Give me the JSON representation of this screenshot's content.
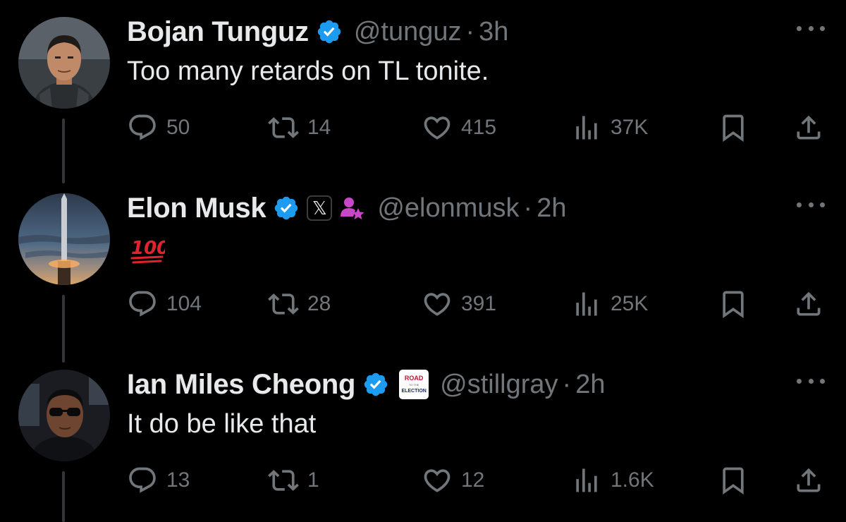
{
  "colors": {
    "background": "#000000",
    "text_primary": "#e7e9ea",
    "text_secondary": "#71767b",
    "verified_blue": "#1d9bf0",
    "affiliate_purple": "#c846c8"
  },
  "tweets": [
    {
      "name": "Bojan Tunguz",
      "handle": "@tunguz",
      "separator": "·",
      "time": "3h",
      "text": "Too many retards on TL tonite.",
      "replies": "50",
      "reposts": "14",
      "likes": "415",
      "views": "37K",
      "badges": [
        "verified-badge-icon"
      ]
    },
    {
      "name": "Elon Musk",
      "handle": "@elonmusk",
      "separator": "·",
      "time": "2h",
      "text": "",
      "emoji": "hundred-points-emoji",
      "x_badge": "𝕏",
      "replies": "104",
      "reposts": "28",
      "likes": "391",
      "views": "25K",
      "badges": [
        "verified-badge-icon",
        "x-affiliate-badge-icon",
        "person-star-icon"
      ]
    },
    {
      "name": "Ian Miles Cheong",
      "handle": "@stillgray",
      "separator": "·",
      "time": "2h",
      "text": "It do be like that",
      "affiliate_badge": {
        "line1": "ROAD",
        "line2": "TO THE",
        "line3": "ELECTION"
      },
      "replies": "13",
      "reposts": "1",
      "likes": "12",
      "views": "1.6K",
      "badges": [
        "verified-badge-icon",
        "road-to-election-badge-icon"
      ]
    }
  ]
}
